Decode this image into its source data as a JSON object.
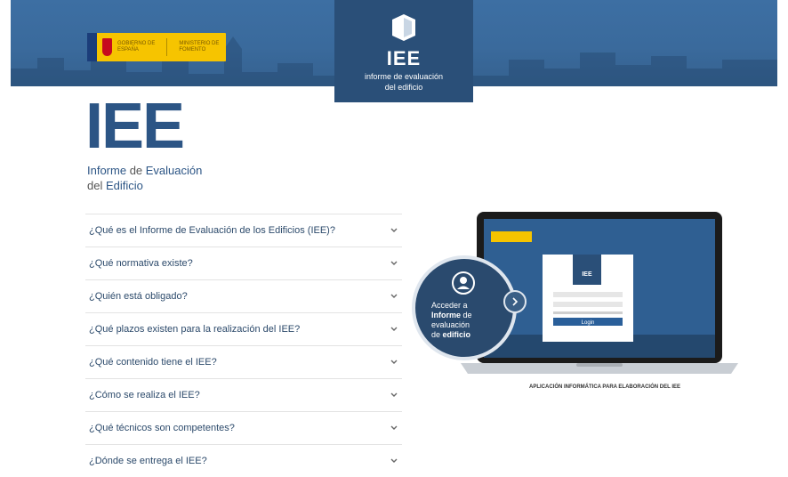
{
  "header": {
    "gov_logo_line1": "GOBIERNO DE ESPAÑA",
    "gov_logo_line2": "MINISTERIO DE FOMENTO",
    "badge_title": "IEE",
    "badge_subtitle_line1": "informe de evaluación",
    "badge_subtitle_line2": "del edificio"
  },
  "hero": {
    "title": "IEE",
    "sub_line1_a": "Informe",
    "sub_line1_b": " de ",
    "sub_line1_c": "Evaluación",
    "sub_line2_a": "del ",
    "sub_line2_b": "Edificio"
  },
  "faq": [
    {
      "q": "¿Qué es el Informe de Evaluación de los Edificios (IEE)?"
    },
    {
      "q": "¿Qué normativa existe?"
    },
    {
      "q": "¿Quién está obligado?"
    },
    {
      "q": "¿Qué plazos existen para la realización del IEE?"
    },
    {
      "q": "¿Qué contenido tiene el IEE?"
    },
    {
      "q": "¿Cómo se realiza el IEE?"
    },
    {
      "q": "¿Qué técnicos son competentes?"
    },
    {
      "q": "¿Dónde se entrega el IEE?"
    }
  ],
  "app_access": {
    "line1": "Acceder a",
    "line2_a": "Informe",
    "line2_b": " de",
    "line3": "evaluación",
    "line4_a": "de ",
    "line4_b": "edificio",
    "screen_brand": "IEE",
    "login_label": "Login",
    "caption": "APLICACIÓN INFORMÁTICA PARA ELABORACIÓN DEL IEE"
  },
  "colors": {
    "header_blue": "#3d6fa3",
    "badge_navy": "#2a4f78",
    "title_blue": "#2c5585",
    "gov_yellow": "#f6c400"
  }
}
